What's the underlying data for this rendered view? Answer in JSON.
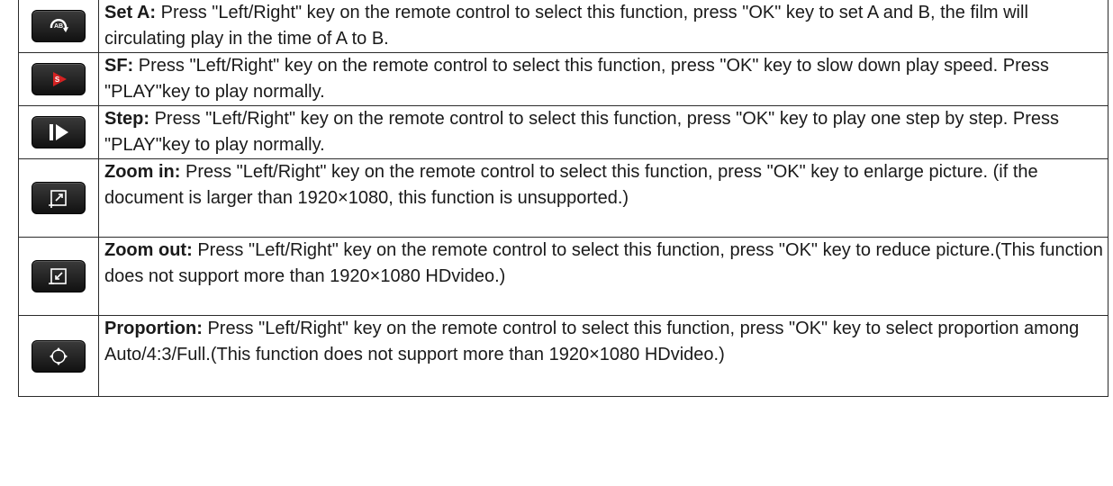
{
  "rows": [
    {
      "icon": "ab-repeat-icon",
      "name": "Set A:",
      "description": "Press \"Left/Right\" key on the remote control to select this function, press \"OK\" key to set A and B, the film will circulating play in the time of A to B."
    },
    {
      "icon": "slow-forward-icon",
      "name": "SF:",
      "description": "Press \"Left/Right\" key on the remote control to select this function, press \"OK\" key to slow down play speed. Press \"PLAY\"key to play normally."
    },
    {
      "icon": "step-icon",
      "name": "Step:",
      "description": "Press \"Left/Right\" key on the remote control to select this function, press \"OK\" key to play one step by step. Press \"PLAY\"key to play normally."
    },
    {
      "icon": "zoom-in-icon",
      "name": "Zoom in:",
      "description": "Press \"Left/Right\" key on the remote control to select this function, press \"OK\" key to enlarge picture. (if the document is larger than 1920×1080, this function is unsupported.)"
    },
    {
      "icon": "zoom-out-icon",
      "name": "Zoom out:",
      "description": "Press \"Left/Right\" key on the remote control to select this function, press \"OK\" key to reduce  picture.(This function does not support more than 1920×1080 HDvideo.)"
    },
    {
      "icon": "proportion-icon",
      "name": "Proportion:",
      "description": "Press \"Left/Right\" key on the remote control to select this function, press \"OK\" key to select  proportion  among  Auto/4:3/Full.(This function does not support more than 1920×1080 HDvideo.)"
    }
  ]
}
